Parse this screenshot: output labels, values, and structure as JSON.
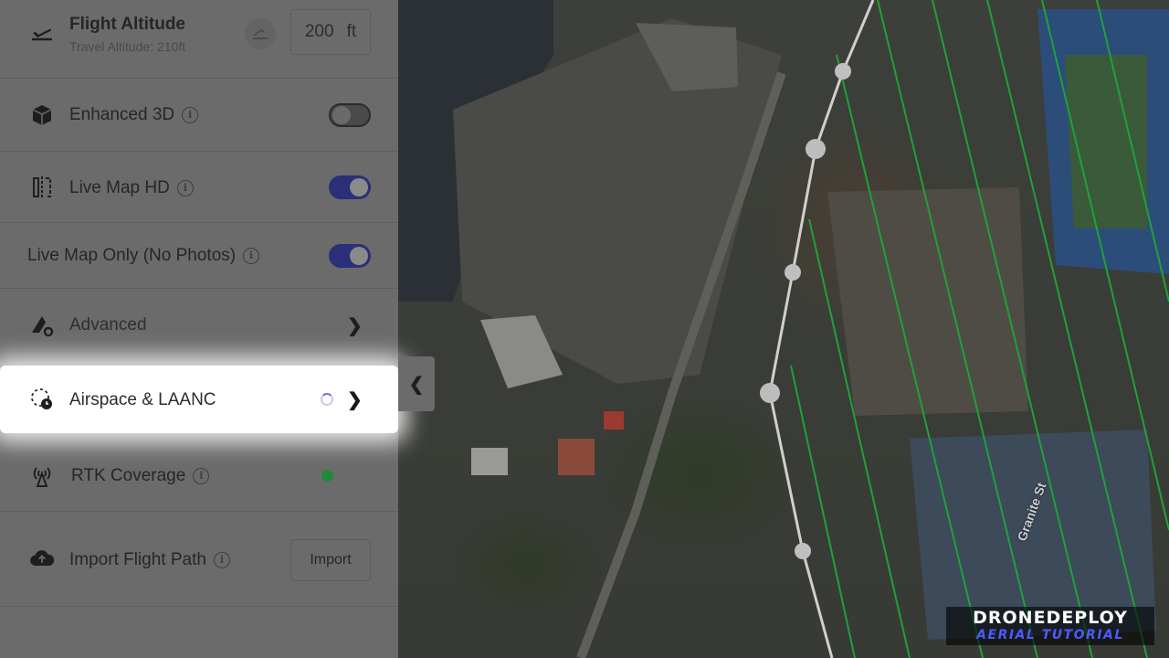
{
  "panel": {
    "flight_altitude": {
      "label": "Flight Altitude",
      "sublabel": "Travel Altitude: 210ft",
      "value": "200",
      "unit": "ft",
      "icon": "plane-takeoff-icon"
    },
    "enhanced_3d": {
      "label": "Enhanced 3D",
      "icon": "cube-icon",
      "enabled": false
    },
    "live_map_hd": {
      "label": "Live Map HD",
      "icon": "map-split-icon",
      "enabled": true
    },
    "live_map_only": {
      "label": "Live Map Only (No Photos)",
      "enabled": true
    },
    "advanced": {
      "label": "Advanced",
      "icon": "drone-gear-icon"
    },
    "airspace": {
      "label": "Airspace & LAANC",
      "icon": "airspace-clock-icon"
    },
    "rtk": {
      "label": "RTK Coverage",
      "icon": "antenna-icon",
      "status_color": "#1f8a3a"
    },
    "import_flight_path": {
      "label": "Import Flight Path",
      "icon": "cloud-upload-icon",
      "button_label": "Import"
    }
  },
  "map": {
    "street_label": "Granite St",
    "flight_line_color": "#1fa13a"
  },
  "colors": {
    "toggle_on": "#2a2f78",
    "highlight": "#ffffff"
  },
  "watermark": {
    "line1": "DRONEDEPLOY",
    "line2": "AERIAL TUTORIAL"
  }
}
